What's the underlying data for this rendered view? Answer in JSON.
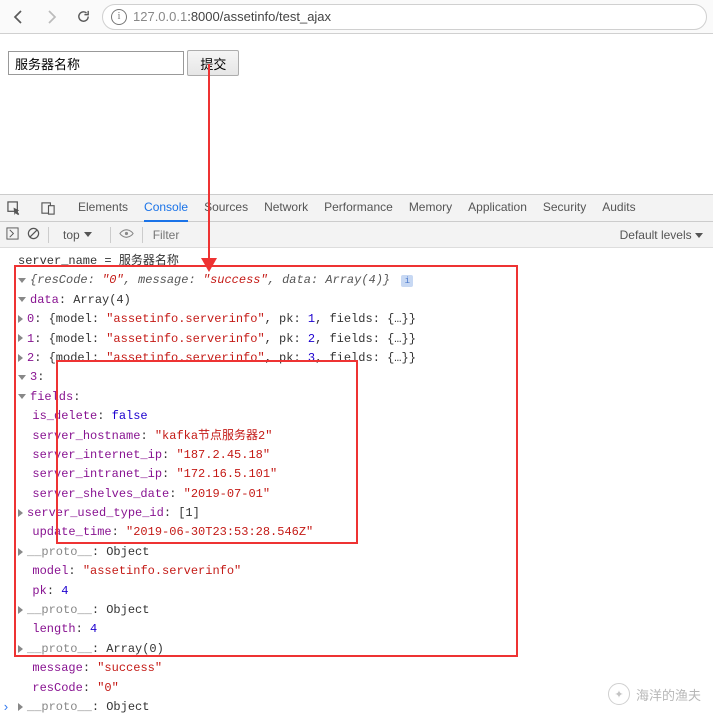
{
  "nav": {
    "url_gray": "127.0.0.1",
    "url_rest": ":8000/assetinfo/test_ajax"
  },
  "page": {
    "input_value": "服务器名称",
    "submit_label": "提交"
  },
  "devtools": {
    "tabs": [
      "Elements",
      "Console",
      "Sources",
      "Network",
      "Performance",
      "Memory",
      "Application",
      "Security",
      "Audits"
    ],
    "active_tab": "Console",
    "context": "top",
    "filter_placeholder": "Filter",
    "levels": "Default levels"
  },
  "log": {
    "server_name_line": "server_name = 服务器名称",
    "root_summary_parts": {
      "resCode_k": "resCode",
      "resCode_v": "\"0\"",
      "message_k": "message",
      "message_v": "\"success\"",
      "data_k": "data",
      "data_v": "Array(4)"
    },
    "data_header": "data: Array(4)",
    "rows": [
      {
        "idx": "0",
        "model": "\"assetinfo.serverinfo\"",
        "pk": "1"
      },
      {
        "idx": "1",
        "model": "\"assetinfo.serverinfo\"",
        "pk": "2"
      },
      {
        "idx": "2",
        "model": "\"assetinfo.serverinfo\"",
        "pk": "3"
      }
    ],
    "row3_idx": "3",
    "fields_label": "fields:",
    "fields": {
      "is_delete": "false",
      "server_hostname": "\"kafka节点服务器2\"",
      "server_internet_ip": "\"187.2.45.18\"",
      "server_intranet_ip": "\"172.16.5.101\"",
      "server_shelves_date": "\"2019-07-01\"",
      "server_used_type_id_label": "server_used_type_id",
      "server_used_type_id_val": "[1]",
      "update_time": "\"2019-06-30T23:53:28.546Z\"",
      "proto": "Object"
    },
    "row3_model": "\"assetinfo.serverinfo\"",
    "row3_pk": "4",
    "after": {
      "proto1": "Object",
      "length_k": "length",
      "length_v": "4",
      "proto2": "Array(0)",
      "message_k": "message",
      "message_v": "\"success\"",
      "rescode_k": "resCode",
      "rescode_v": "\"0\"",
      "proto3": "Object"
    }
  },
  "watermark": "海洋的渔夫"
}
